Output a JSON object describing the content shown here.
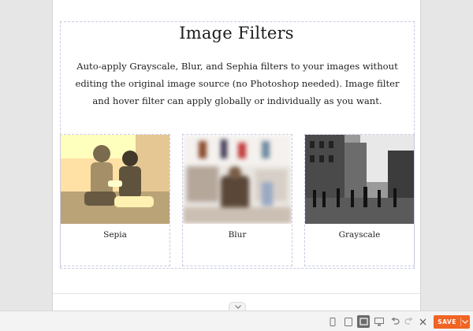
{
  "page": {
    "title": "Image Filters",
    "description": "Auto-apply Grayscale, Blur, and Sephia filters to your images without editing the original image source (no Photoshop needed). Image filter and hover filter can apply globally or individually as you want."
  },
  "gallery": {
    "items": [
      {
        "caption": "Sepia",
        "filter": "sepia"
      },
      {
        "caption": "Blur",
        "filter": "blur"
      },
      {
        "caption": "Grayscale",
        "filter": "grayscale"
      }
    ]
  },
  "toolbar": {
    "save_label": "SAVE",
    "icons": [
      "mobile-view-icon",
      "tablet-view-icon",
      "laptop-view-icon",
      "desktop-view-icon",
      "undo-icon",
      "redo-icon",
      "close-icon"
    ],
    "active_view": "laptop-view-icon"
  },
  "colors": {
    "save_button": "#f06424",
    "section_border": "#c9cce2",
    "toolbar_bg": "#f3f3f3"
  }
}
